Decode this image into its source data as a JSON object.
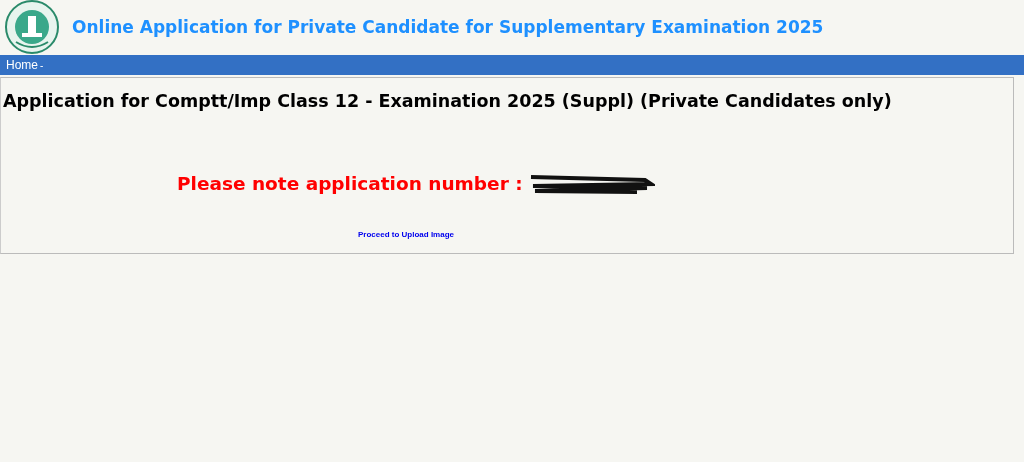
{
  "header": {
    "title": "Online Application for Private Candidate for Supplementary Examination 2025"
  },
  "nav": {
    "items": [
      {
        "label": "Home"
      }
    ],
    "separator": "-"
  },
  "content": {
    "heading": "Application for Comptt/Imp Class 12 - Examination 2025 (Suppl) (Private Candidates only)",
    "notice": "Please note application number :",
    "link": "Proceed to Upload Image"
  }
}
